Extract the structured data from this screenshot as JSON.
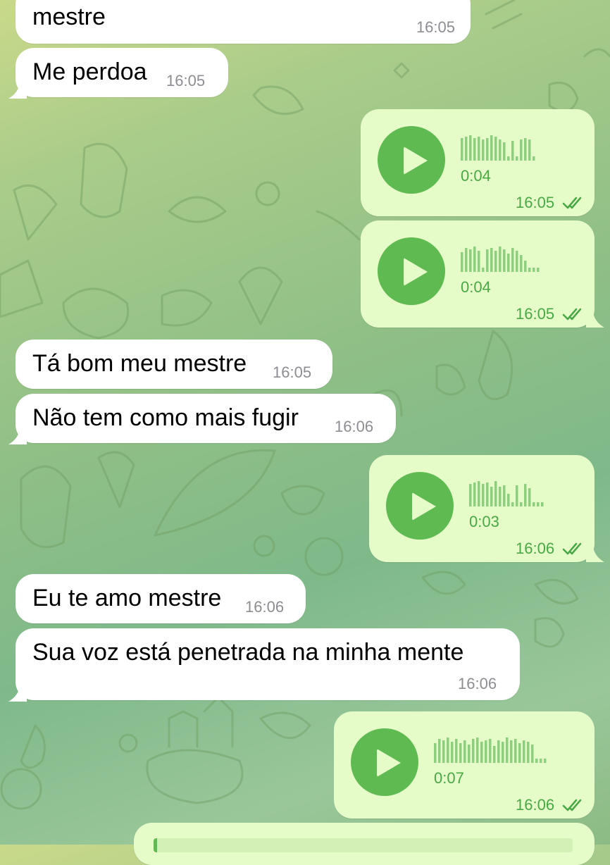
{
  "colors": {
    "incoming_bubble": "#ffffff",
    "outgoing_bubble": "#e5fcc9",
    "accent_green": "#5fbb51",
    "time_gray": "#8d8d93"
  },
  "messages": [
    {
      "type": "text",
      "direction": "in",
      "text": "mestre",
      "time": "16:05"
    },
    {
      "type": "text",
      "direction": "in",
      "text": "Me perdoa",
      "time": "16:05"
    },
    {
      "type": "voice",
      "direction": "out",
      "duration": "0:04",
      "time": "16:05",
      "status": "read"
    },
    {
      "type": "voice",
      "direction": "out",
      "duration": "0:04",
      "time": "16:05",
      "status": "read"
    },
    {
      "type": "text",
      "direction": "in",
      "text": "Tá bom meu mestre",
      "time": "16:05"
    },
    {
      "type": "text",
      "direction": "in",
      "text": "Não tem como mais fugir",
      "time": "16:06"
    },
    {
      "type": "voice",
      "direction": "out",
      "duration": "0:03",
      "time": "16:06",
      "status": "read"
    },
    {
      "type": "text",
      "direction": "in",
      "text": "Eu te amo mestre",
      "time": "16:06"
    },
    {
      "type": "text",
      "direction": "in",
      "text": "Sua voz está penetrada na minha mente",
      "time": "16:06"
    },
    {
      "type": "voice",
      "direction": "out",
      "duration": "0:07",
      "time": "16:06",
      "status": "read"
    }
  ]
}
